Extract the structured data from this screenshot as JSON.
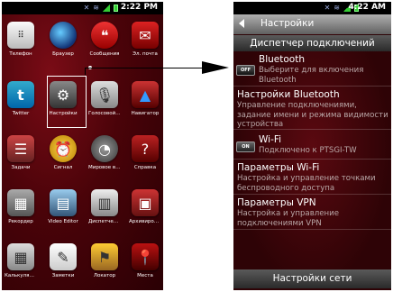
{
  "left_phone": {
    "status_time": "2:22 PM",
    "apps": [
      {
        "label": "Телефон",
        "icon": "keypad-icon",
        "glyph": "⠿"
      },
      {
        "label": "Браузер",
        "icon": "globe-icon",
        "glyph": ""
      },
      {
        "label": "Сообщения",
        "icon": "message-bubble-icon",
        "glyph": "❝"
      },
      {
        "label": "Эл. почта",
        "icon": "envelope-icon",
        "glyph": "✉"
      },
      {
        "label": "Twitter",
        "icon": "twitter-bird-icon",
        "glyph": "t"
      },
      {
        "label": "Настройки",
        "icon": "gear-icon",
        "glyph": "⚙"
      },
      {
        "label": "Голосовой п...",
        "icon": "microphone-icon",
        "glyph": "🎙"
      },
      {
        "label": "Навигатор",
        "icon": "navigation-arrow-icon",
        "glyph": "▲"
      },
      {
        "label": "Задачи",
        "icon": "tasks-icon",
        "glyph": "☰"
      },
      {
        "label": "Сигнал",
        "icon": "alarm-clock-icon",
        "glyph": "⏰"
      },
      {
        "label": "Мировое вре...",
        "icon": "world-clock-icon",
        "glyph": "◔"
      },
      {
        "label": "Справка",
        "icon": "help-book-icon",
        "glyph": "?"
      },
      {
        "label": "Рекордер",
        "icon": "recorder-icon",
        "glyph": "▦"
      },
      {
        "label": "Video Editor",
        "icon": "film-icon",
        "glyph": "▤"
      },
      {
        "label": "Диспетчер ф...",
        "icon": "task-manager-icon",
        "glyph": "▥"
      },
      {
        "label": "Архивирова...",
        "icon": "archive-icon",
        "glyph": "▣"
      },
      {
        "label": "Калькулятор",
        "icon": "calculator-icon",
        "glyph": "▦"
      },
      {
        "label": "Заметки",
        "icon": "notes-icon",
        "glyph": "✎"
      },
      {
        "label": "Локатор",
        "icon": "locator-icon",
        "glyph": "⚑"
      },
      {
        "label": "Места",
        "icon": "map-pin-icon",
        "glyph": "📍"
      }
    ]
  },
  "right_phone": {
    "status_time": "4:22 AM",
    "header_title": "Настройки",
    "subheader": "Диспетчер подключений",
    "bluetooth": {
      "title": "Bluetooth",
      "subtitle": "Выберите для включения Bluetooth",
      "toggle": "OFF"
    },
    "bluetooth_settings": {
      "title": "Настройки Bluetooth",
      "subtitle": "Управление подключениями, задание имени и режима видимости устройства"
    },
    "wifi": {
      "title": "Wi-Fi",
      "subtitle": "Подключено к PTSGI-TW",
      "toggle": "ON"
    },
    "wifi_settings": {
      "title": "Параметры Wi-Fi",
      "subtitle": "Настройка и управление точками беспроводного доступа"
    },
    "vpn_settings": {
      "title": "Параметры VPN",
      "subtitle": "Настройка и управление подключениями VPN"
    },
    "footer": "Настройки сети"
  }
}
